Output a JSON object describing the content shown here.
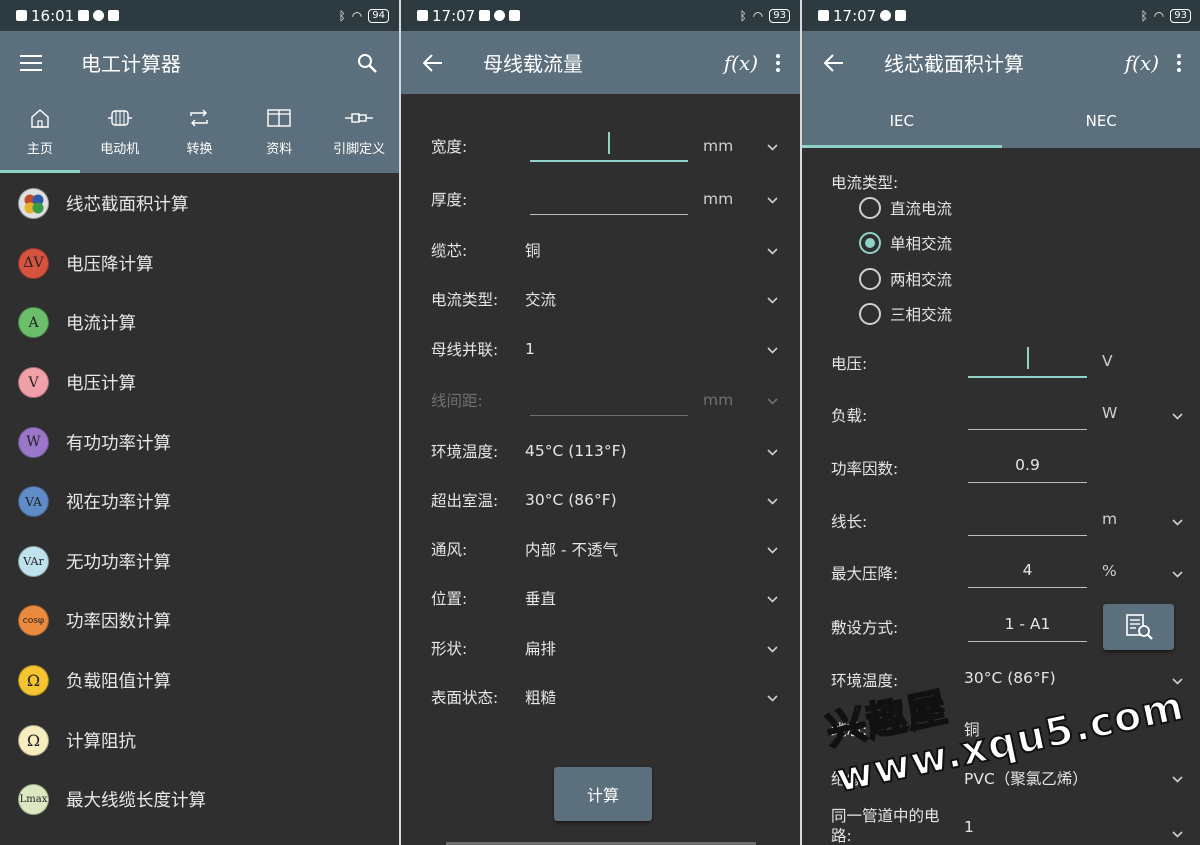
{
  "screen1": {
    "status": {
      "time": "16:01",
      "battery": "94"
    },
    "title": "电工计算器",
    "tabs": [
      {
        "label": "主页",
        "icon": "home-icon"
      },
      {
        "label": "电动机",
        "icon": "motor-icon"
      },
      {
        "label": "转换",
        "icon": "convert-icon"
      },
      {
        "label": "资料",
        "icon": "book-icon"
      },
      {
        "label": "引脚定义",
        "icon": "connector-icon"
      }
    ],
    "items": [
      {
        "label": "线芯截面积计算",
        "badge": "",
        "color": "#cfcfcf"
      },
      {
        "label": "电压降计算",
        "badge": "ΔV",
        "color": "#d6533f"
      },
      {
        "label": "电流计算",
        "badge": "A",
        "color": "#6cbf6a"
      },
      {
        "label": "电压计算",
        "badge": "V",
        "color": "#f1a0a8"
      },
      {
        "label": "有功功率计算",
        "badge": "W",
        "color": "#9b77c9"
      },
      {
        "label": "视在功率计算",
        "badge": "VA",
        "color": "#5f8bc7"
      },
      {
        "label": "无功功率计算",
        "badge": "VAr",
        "color": "#bfe3ee"
      },
      {
        "label": "功率因数计算",
        "badge": "cosφ",
        "color": "#e98a3f"
      },
      {
        "label": "负载阻值计算",
        "badge": "Ω",
        "color": "#f4c531"
      },
      {
        "label": "计算阻抗",
        "badge": "Ω",
        "color": "#f6eec0"
      },
      {
        "label": "最大线缆长度计算",
        "badge": "Lmax",
        "color": "#dbe8c1"
      }
    ]
  },
  "screen2": {
    "status": {
      "time": "17:07",
      "battery": "93"
    },
    "title": "母线载流量",
    "fx": "f(x)",
    "rows": [
      {
        "label": "宽度:",
        "value": "",
        "unit": "mm"
      },
      {
        "label": "厚度:",
        "value": "",
        "unit": "mm"
      },
      {
        "label": "缆芯:",
        "value": "铜",
        "unit": ""
      },
      {
        "label": "电流类型:",
        "value": "交流",
        "unit": ""
      },
      {
        "label": "母线并联:",
        "value": "1",
        "unit": ""
      },
      {
        "label": "线间距:",
        "value": "",
        "unit": "mm"
      },
      {
        "label": "环境温度:",
        "value": "45°C (113°F)",
        "unit": ""
      },
      {
        "label": "超出室温:",
        "value": "30°C (86°F)",
        "unit": ""
      },
      {
        "label": "通风:",
        "value": "内部 - 不透气",
        "unit": ""
      },
      {
        "label": "位置:",
        "value": "垂直",
        "unit": ""
      },
      {
        "label": "形状:",
        "value": "扁排",
        "unit": ""
      },
      {
        "label": "表面状态:",
        "value": "粗糙",
        "unit": ""
      }
    ],
    "calc": "计算"
  },
  "screen3": {
    "status": {
      "time": "17:07",
      "battery": "93"
    },
    "title": "线芯截面积计算",
    "fx": "f(x)",
    "tabs": [
      "IEC",
      "NEC"
    ],
    "current_type_label": "电流类型:",
    "radios": [
      "直流电流",
      "单相交流",
      "两相交流",
      "三相交流"
    ],
    "fields": {
      "voltage": {
        "label": "电压:",
        "value": "",
        "unit": "V"
      },
      "load": {
        "label": "负载:",
        "value": "",
        "unit": "W"
      },
      "pf": {
        "label": "功率因数:",
        "value": "0.9",
        "unit": ""
      },
      "length": {
        "label": "线长:",
        "value": "",
        "unit": "m"
      },
      "drop": {
        "label": "最大压降:",
        "value": "4",
        "unit": "%"
      },
      "install": {
        "label": "敷设方式:",
        "value": "1 - A1",
        "unit": ""
      },
      "temp": {
        "label": "环境温度:",
        "value": "30°C (86°F)"
      },
      "core": {
        "label": "缆芯:",
        "value": "铜"
      },
      "insulation": {
        "label": "绝缘:",
        "value": "PVC（聚氯乙烯）"
      },
      "circuits": {
        "label": "同一管道中的电路:",
        "value": "1"
      }
    }
  },
  "watermark": "兴趣屋 www.xqu5.com"
}
